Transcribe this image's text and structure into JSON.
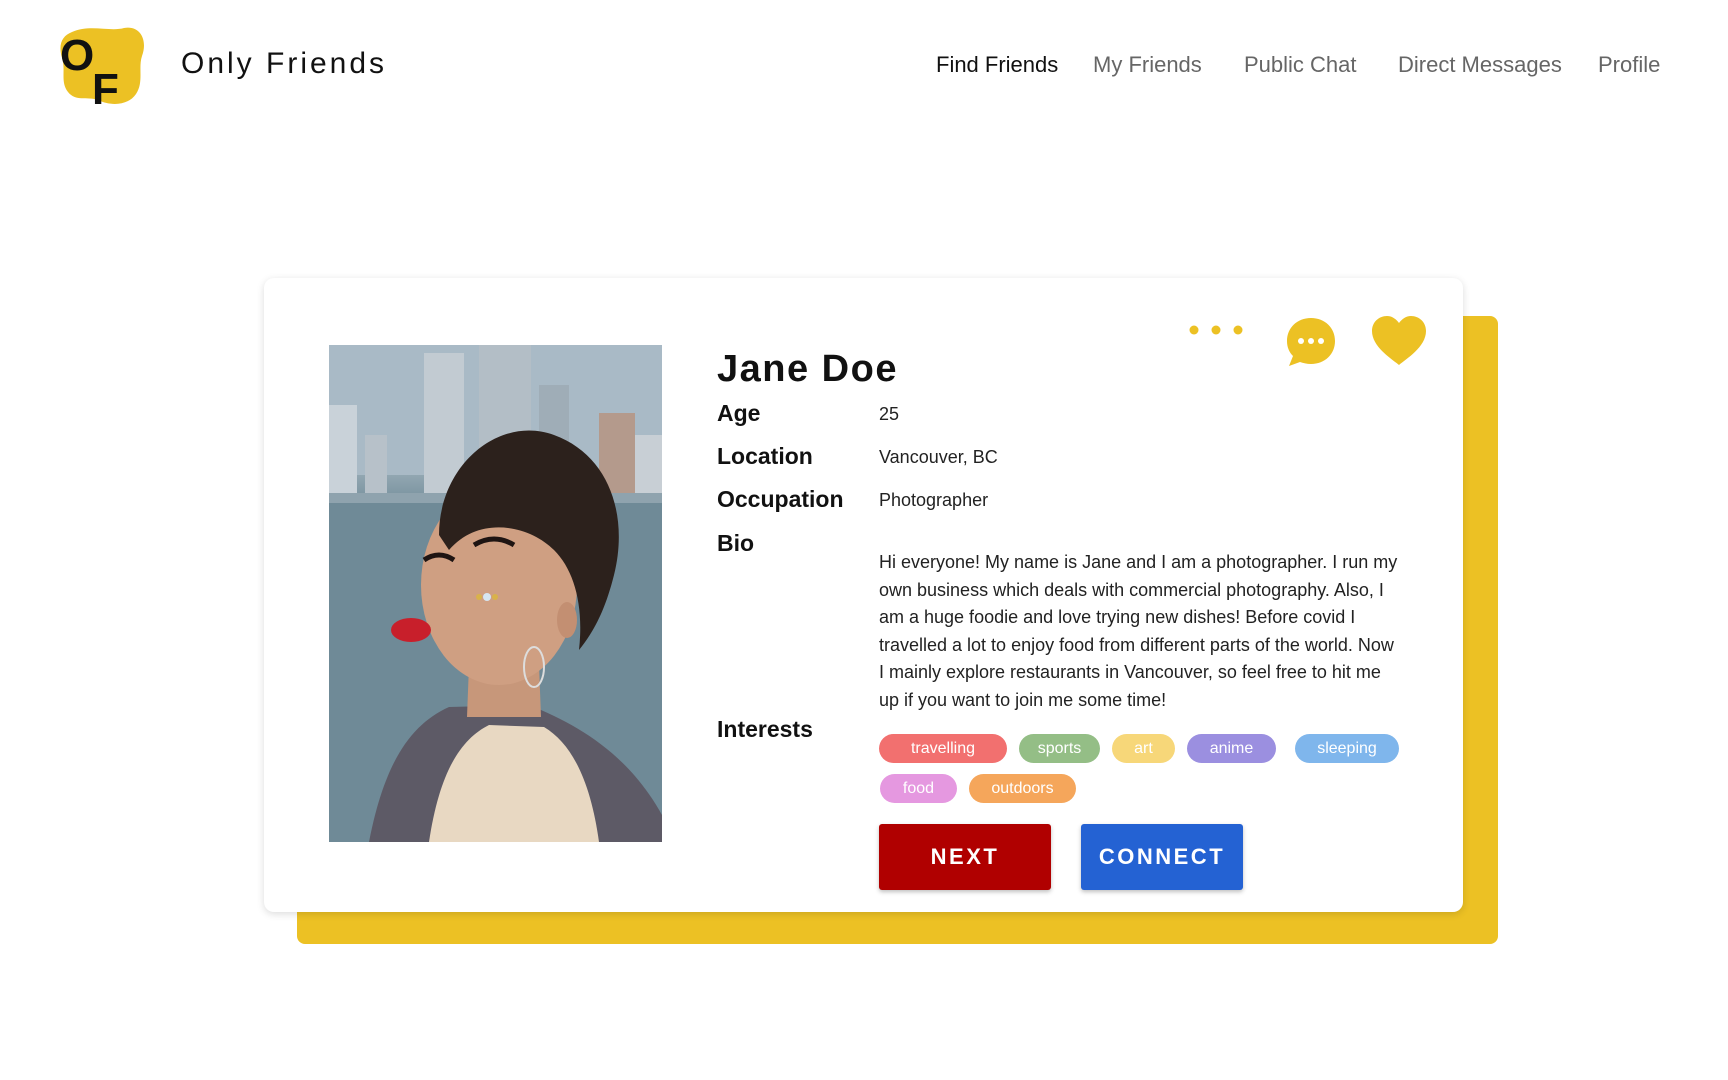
{
  "header": {
    "logo_letters": "OF",
    "brand": "Only Friends",
    "nav": [
      {
        "label": "Find Friends",
        "active": true
      },
      {
        "label": "My Friends",
        "active": false
      },
      {
        "label": "Public Chat",
        "active": false
      },
      {
        "label": "Direct Messages",
        "active": false
      },
      {
        "label": "Profile",
        "active": false
      }
    ]
  },
  "profile": {
    "name": "Jane Doe",
    "fields": {
      "age_label": "Age",
      "age": "25",
      "location_label": "Location",
      "location": "Vancouver, BC",
      "occupation_label": "Occupation",
      "occupation": "Photographer",
      "bio_label": "Bio",
      "bio": "Hi everyone! My name is Jane and I am a photographer. I run my own business which deals with commercial photography. Also, I am a huge foodie and love trying new dishes! Before covid I travelled a lot to enjoy food from different parts of the world. Now I mainly explore restaurants in Vancouver, so feel free to hit me up if you want to join me some time!",
      "interests_label": "Interests"
    },
    "interests": [
      {
        "label": "travelling",
        "color": "#F2706F"
      },
      {
        "label": "sports",
        "color": "#94BE86"
      },
      {
        "label": "art",
        "color": "#F7D779"
      },
      {
        "label": "anime",
        "color": "#9B8FE0"
      },
      {
        "label": "sleeping",
        "color": "#7FB6EC"
      },
      {
        "label": "food",
        "color": "#E598E0"
      },
      {
        "label": "outdoors",
        "color": "#F5A65B"
      }
    ],
    "icons": {
      "more": "more-options-icon",
      "chat": "chat-bubble-icon",
      "like": "heart-icon"
    }
  },
  "actions": {
    "next_label": "NEXT",
    "connect_label": "CONNECT"
  },
  "colors": {
    "accent_yellow": "#ECC124",
    "next_red": "#B00000",
    "connect_blue": "#2462D3"
  }
}
